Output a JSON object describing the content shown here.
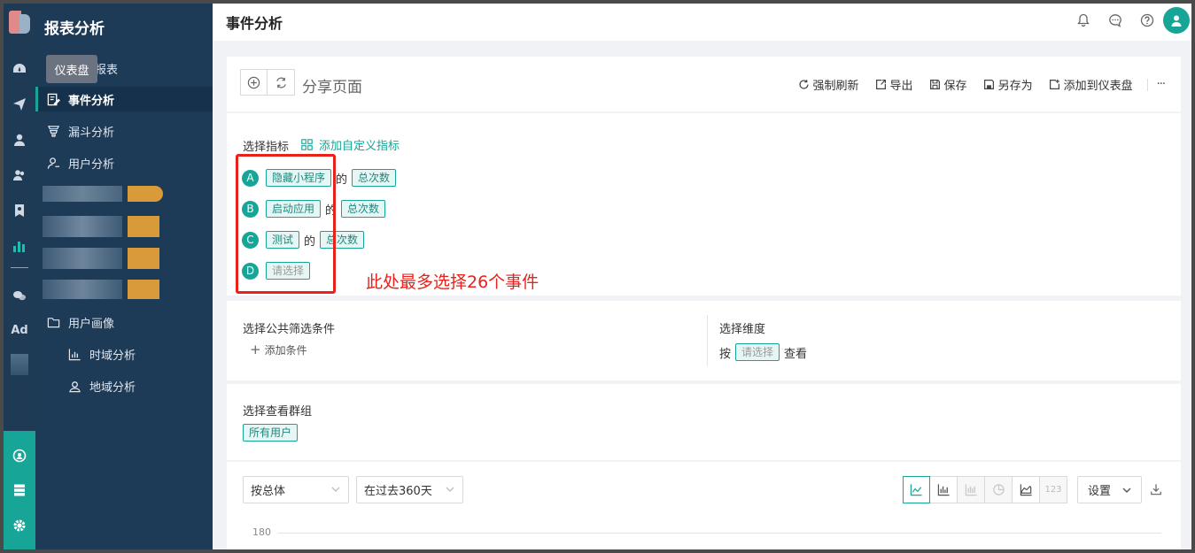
{
  "nav": {
    "title": "报表分析",
    "tooltip": "仪表盘",
    "items": [
      {
        "label": "报表"
      },
      {
        "label": "事件分析"
      },
      {
        "label": "漏斗分析"
      },
      {
        "label": "用户分析"
      },
      {
        "label": "用户画像"
      },
      {
        "label": "时域分析"
      },
      {
        "label": "地域分析"
      }
    ]
  },
  "rail": {
    "ad_label": "Ad"
  },
  "header": {
    "title": "事件分析"
  },
  "toolbar": {
    "share_label": "分享页面",
    "actions": [
      "强制刷新",
      "导出",
      "保存",
      "另存为",
      "添加到仪表盘"
    ],
    "more": "···"
  },
  "metrics": {
    "section_label": "选择指标",
    "add_custom": "添加自定义指标",
    "rows": [
      {
        "letter": "A",
        "event": "隐藏小程序",
        "of": "的",
        "measure": "总次数"
      },
      {
        "letter": "B",
        "event": "启动应用",
        "of": "的",
        "measure": "总次数"
      },
      {
        "letter": "C",
        "event": "测试",
        "of": "的",
        "measure": "总次数"
      },
      {
        "letter": "D",
        "event": "请选择"
      }
    ],
    "annotation": "此处最多选择26个事件",
    "annotation_color": "#e8211a"
  },
  "filters": {
    "label": "选择公共筛选条件",
    "add_condition": "添加条件",
    "plus": "+"
  },
  "dimension": {
    "label": "选择维度",
    "prefix": "按",
    "select": "请选择",
    "suffix": "查看"
  },
  "group": {
    "label": "选择查看群组",
    "value": "所有用户"
  },
  "chart_controls": {
    "group_by": "按总体",
    "time_range": "在过去360天",
    "number_view": "123",
    "settings": "设置",
    "y_tick": "180"
  },
  "colors": {
    "accent": "#17a597",
    "sidebar": "#1d3a57",
    "annotation": "#e8211a"
  }
}
